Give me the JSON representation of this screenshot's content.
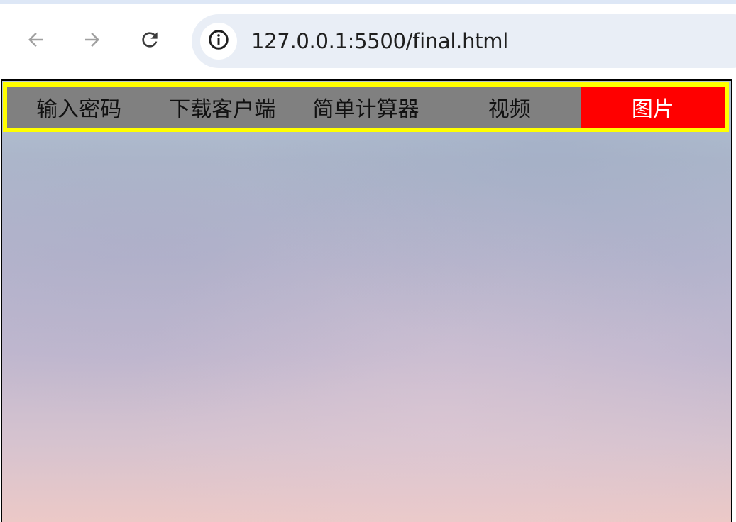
{
  "browser": {
    "url": "127.0.0.1:5500/final.html",
    "icons": {
      "back": "arrow-left-icon",
      "forward": "arrow-right-icon",
      "reload": "reload-icon",
      "site_info": "info-icon"
    }
  },
  "page": {
    "nav": {
      "items": [
        {
          "label": "输入密码",
          "active": false
        },
        {
          "label": "下载客户端",
          "active": false
        },
        {
          "label": "简单计算器",
          "active": false
        },
        {
          "label": "视频",
          "active": false
        },
        {
          "label": "图片",
          "active": true
        }
      ]
    },
    "colors": {
      "nav_background": "#808080",
      "nav_border": "#ffff00",
      "nav_active_background": "#ff0000",
      "nav_active_text": "#ffffff"
    }
  }
}
